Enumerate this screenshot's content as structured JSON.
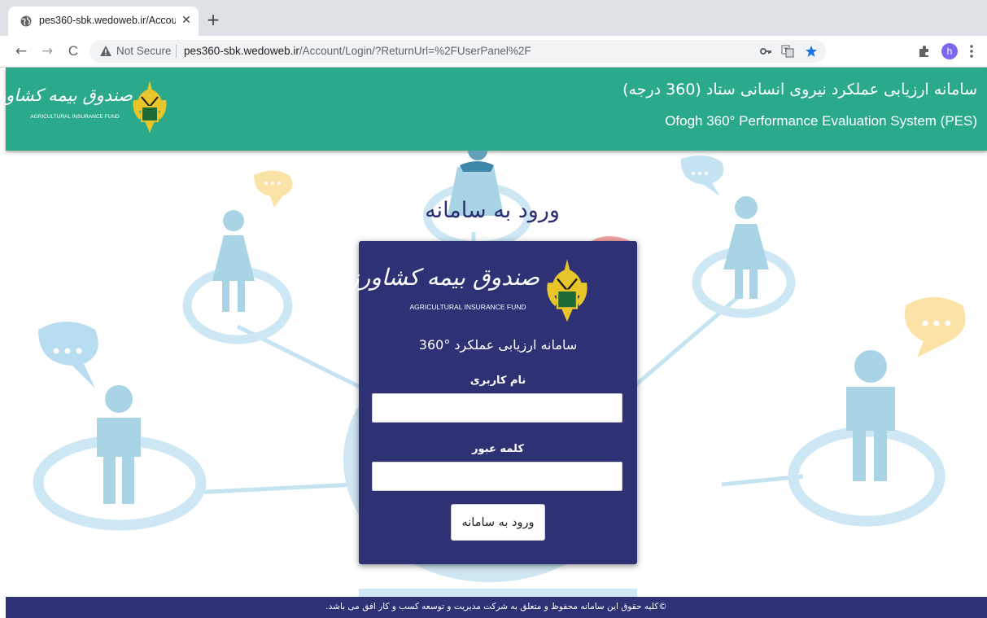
{
  "browser": {
    "tab_title": "pes360-sbk.wedoweb.ir/Accou",
    "tab_close": "✕",
    "new_tab": "+",
    "back": "←",
    "forward": "→",
    "reload": "C",
    "security_label": "Not Secure",
    "url_host": "pes360-sbk.wedoweb.ir",
    "url_path": "/Account/Login/?ReturnUrl=%2FUserPanel%2F",
    "profile_initial": "h",
    "icons": [
      "globe-icon",
      "warning-icon",
      "key-icon",
      "translate-icon",
      "star-icon",
      "puzzle-icon",
      "menu-icon"
    ],
    "star_color": "#1a73e8",
    "profile_color": "#7b68ee"
  },
  "header": {
    "title_fa": "سامانه ارزیابی عملکرد نیروی انسانی ستاد (360 درجه)",
    "title_en": "Ofogh 360° Performance Evaluation System (PES)",
    "logo_name": "صندوق بیمه کشاورزی",
    "logo_sub": "AGRICULTURAL INSURANCE FUND",
    "bg_color": "#2aaa8a"
  },
  "login": {
    "heading": "ورود به سامانه",
    "logo_name": "صندوق بیمه کشاورزی",
    "logo_sub": "AGRICULTURAL INSURANCE FUND",
    "system_title": "سامانه ارزیابی عملکرد °360",
    "username_label": "نام کاربری",
    "username_value": "",
    "password_label": "کلمه عبور",
    "password_value": "",
    "submit_label": "ورود به سامانه",
    "card_color": "#2e3275"
  },
  "footer": {
    "text": "©کلیه حقوق این سامانه محفوظ و متعلق به شرکت مدیریت و توسعه کسب و کار افق می باشد."
  }
}
